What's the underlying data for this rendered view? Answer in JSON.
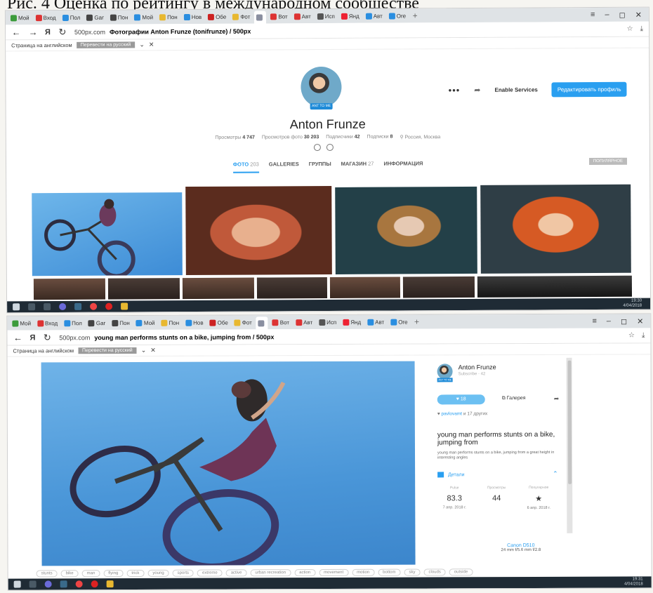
{
  "caption": "Рис. 4 Оценка по рейтингу в международном сообществе",
  "browser": {
    "tabs": [
      "Мой",
      "Вход",
      "Пол",
      "Gar",
      "Пон",
      "Мой",
      "Пон",
      "Нов",
      "Обе",
      "Фот",
      "",
      "Вот",
      "Авт",
      "Исп",
      "Янд",
      "Авт",
      "Ore"
    ],
    "tab_colors": [
      "#3b9b3b",
      "#d33",
      "#2a8ee0",
      "#444",
      "#444",
      "#2a8ee0",
      "#e8b830",
      "#2a8ee0",
      "#c22",
      "#e8b830",
      "#8a8fa0",
      "#d33",
      "#d33",
      "#555",
      "#e23",
      "#2a8ee0",
      "#2a8ee0"
    ],
    "new_tab": "+",
    "win_ctrl": [
      "≡",
      "–",
      "◻",
      "✕"
    ]
  },
  "shot1": {
    "address": {
      "domain": "500px.com",
      "title": "Фотографии Anton Frunze (tonifrunze) / 500px"
    },
    "translate": {
      "label": "Страница на английском",
      "button": "Перевести на русский"
    },
    "profile": {
      "badge": "ANT TO ME",
      "actions": {
        "more": "•••",
        "share": "➦",
        "enable": "Enable Services",
        "edit": "Редактировать профиль"
      },
      "name": "Anton Frunze",
      "stats": [
        {
          "label": "Просмотры",
          "value": "4 747"
        },
        {
          "label": "Просмотров фото",
          "value": "30 203"
        },
        {
          "label": "Подписчики",
          "value": "42"
        },
        {
          "label": "Подписки",
          "value": "8"
        },
        {
          "label": "",
          "value": "⚲ Россия, Москва"
        }
      ],
      "tabs": [
        {
          "label": "ФОТО",
          "count": "203"
        },
        {
          "label": "GALLERIES",
          "count": ""
        },
        {
          "label": "ГРУППЫ",
          "count": ""
        },
        {
          "label": "МАГАЗИН",
          "count": "27"
        },
        {
          "label": "ИНФОРМАЦИЯ",
          "count": ""
        }
      ],
      "sort": "ПОПУЛЯРНОЕ"
    },
    "clock": {
      "time": "19:30",
      "date": "4/04/2018"
    }
  },
  "shot2": {
    "address": {
      "domain": "500px.com",
      "title": "young man performs stunts on a bike, jumping from / 500px"
    },
    "translate": {
      "label": "Страница на английском",
      "button": "Перевести на русский"
    },
    "author": {
      "name": "Anton Frunze",
      "sub": "Subscribe · 42",
      "badge": "ANT TO ME"
    },
    "like": "♥ 18",
    "gallery": "⧉ Галерея",
    "share": "➦",
    "liked_by": {
      "prefix": "♥",
      "name": "pavlovamt",
      "suffix": "и 17 других"
    },
    "title": "young man performs stunts on a bike, jumping from",
    "description": "young man performs stunts on a bike, jumping from a great height in interesting angles",
    "details": "Детали",
    "metrics": [
      {
        "title": "Pulse",
        "value": "83.3",
        "date": "7 апр. 2018 г."
      },
      {
        "title": "Просмотры",
        "value": "44",
        "date": ""
      },
      {
        "title": "Популярное",
        "value": "★",
        "date": "6 апр. 2018 г."
      }
    ],
    "camera": {
      "name": "Canon D510",
      "info": "24 mm f/5.6 mm f/2.8"
    },
    "tags": [
      "stunts",
      "bike",
      "man",
      "flying",
      "trick",
      "young",
      "sports",
      "extreme",
      "active",
      "urban recreation",
      "action",
      "movement",
      "motion",
      "bottom",
      "sky",
      "clouds",
      "outside"
    ],
    "clock": {
      "time": "19:31",
      "date": "4/04/2018"
    }
  }
}
